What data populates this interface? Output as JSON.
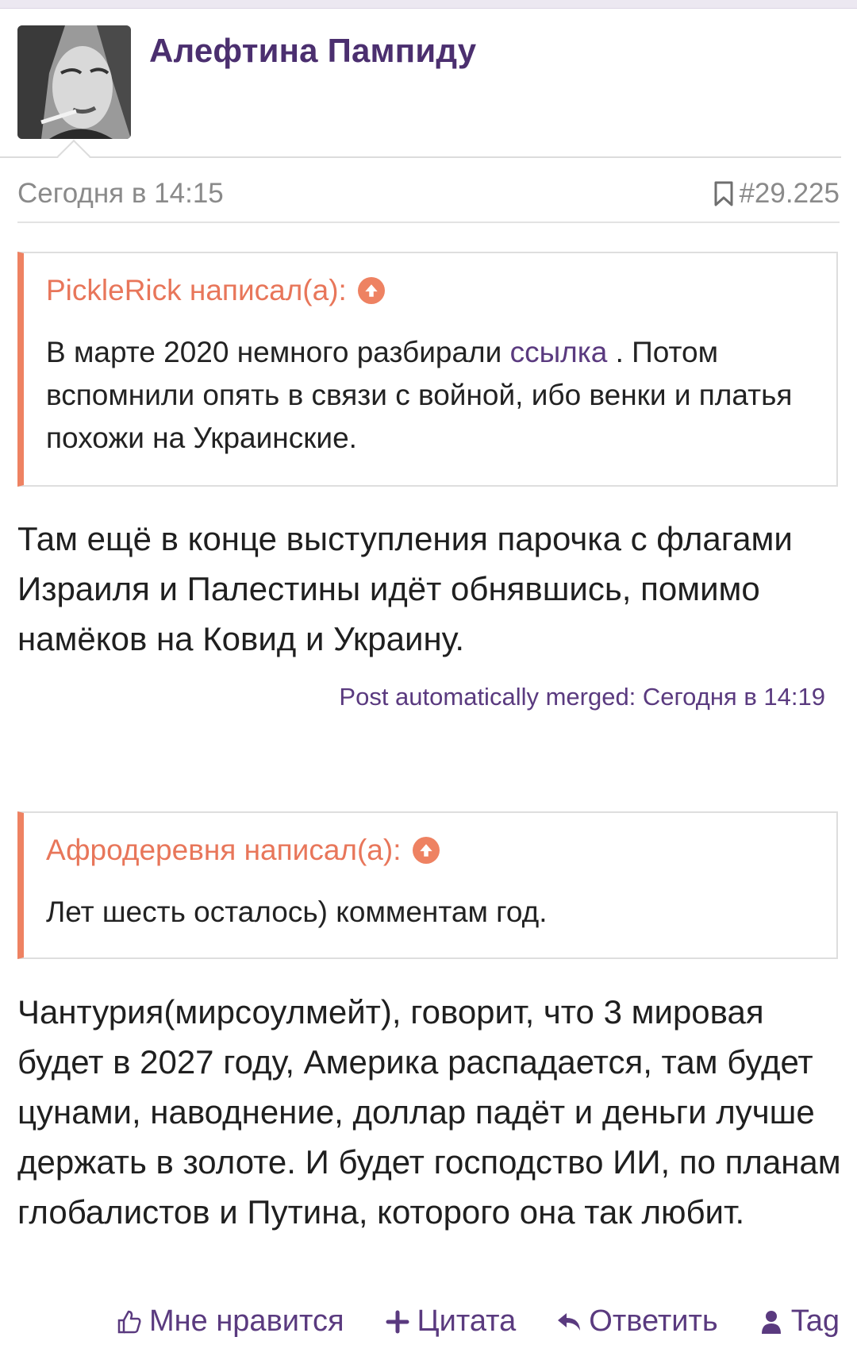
{
  "author": {
    "name": "Алефтина Пампиду"
  },
  "post": {
    "date": "Сегодня в 14:15",
    "number": "#29.225"
  },
  "quotes": [
    {
      "author": "PickleRick написал(а):",
      "text_before": "В марте 2020 немного разбирали",
      "link": "ссылка",
      "text_after": ". Потом вспомнили опять в связи с войной, ибо венки и платья похожи на Украинские."
    },
    {
      "author": "Афродеревня написал(а):",
      "text": "Лет шесть осталось) комментам год."
    }
  ],
  "messages": [
    "Там ещё в конце выступления парочка с флагами Израиля и Палестины идёт обнявшись, помимо намёков на Ковид и Украину.",
    "Чантурия(мирсоулмейт), говорит, что 3 мировая будет в 2027 году, Америка распадается, там будет цунами, наводнение, доллар падёт и деньги лучше держать в золоте. И будет господство ИИ, по планам глобалистов и Путина, которого она так любит."
  ],
  "merged_note": "Post automatically merged: Сегодня в 14:19",
  "actions": {
    "like": "Мне нравится",
    "quote": "Цитата",
    "reply": "Ответить",
    "tag": "Tag"
  },
  "colors": {
    "accent": "#5a3a7f",
    "quote_border": "#ee8262",
    "name": "#4b2f6f"
  }
}
